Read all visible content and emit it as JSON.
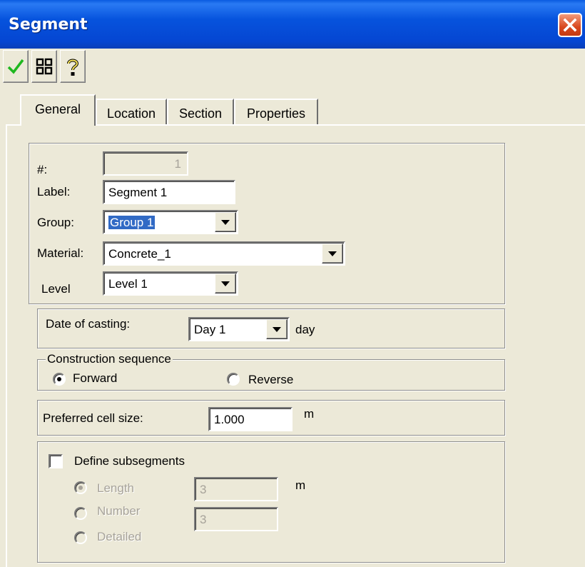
{
  "window": {
    "title": "Segment"
  },
  "toolbar": {
    "buttons": [
      {
        "icon": "checkmark-icon"
      },
      {
        "icon": "grid-icon"
      },
      {
        "icon": "help-icon"
      }
    ]
  },
  "tabs": [
    {
      "label": "General",
      "active": true
    },
    {
      "label": "Location",
      "active": false
    },
    {
      "label": "Section",
      "active": false
    },
    {
      "label": "Properties",
      "active": false
    }
  ],
  "general": {
    "number_label": "#:",
    "number_value": "1",
    "label_label": "Label:",
    "label_value": "Segment 1",
    "group_label": "Group:",
    "group_value": "Group 1",
    "material_label": "Material:",
    "material_value": "Concrete_1",
    "level_label": "Level",
    "level_value": "Level 1"
  },
  "casting": {
    "label": "Date of casting:",
    "value": "Day 1",
    "unit": "day"
  },
  "sequence": {
    "legend": "Construction sequence",
    "options": [
      {
        "label": "Forward",
        "selected": true
      },
      {
        "label": "Reverse",
        "selected": false
      }
    ]
  },
  "cell": {
    "label": "Preferred cell size:",
    "value": "1.000",
    "unit": "m"
  },
  "subsegments": {
    "checkbox_label": "Define subsegments",
    "checked": false,
    "length_label": "Length",
    "length_value": "3",
    "length_unit": "m",
    "number_label": "Number",
    "number_value": "3",
    "detailed_label": "Detailed",
    "selected_option": "Length"
  },
  "colors": {
    "title_bar": "#0653DD",
    "dialog_bg": "#ECE9D8",
    "selection": "#316AC5",
    "close_button": "#D8481E",
    "check_green": "#1FB81F"
  }
}
